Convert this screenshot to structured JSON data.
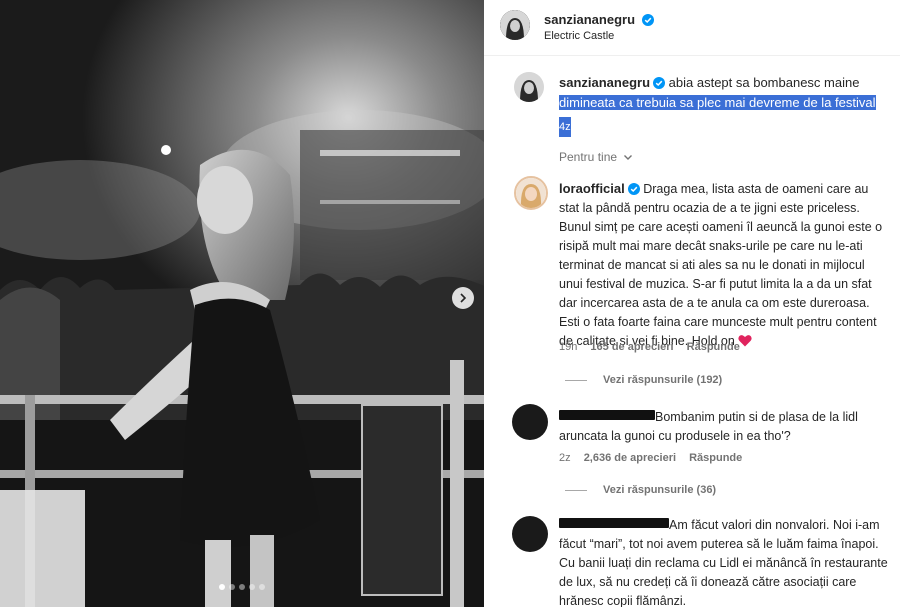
{
  "post": {
    "username": "sanziananegru",
    "location": "Electric Castle",
    "caption_part1": "abia astept sa bombanesc maine",
    "caption_part2": "dimineata ca trebuia sa plec mai devreme de la festival",
    "caption_time": "4z",
    "carousel": {
      "total": 5,
      "active": 0
    }
  },
  "filter": {
    "label": "Pentru tine"
  },
  "comments": [
    {
      "username": "loraofficial",
      "text": "Draga mea, lista asta de oameni care au stat la pândă pentru ocazia de a te jigni este priceless. Bunul simț pe care acești oameni îl aeuncă la gunoi este o risipă mult mai mare decât snaks-urile pe care nu le-ati terminat de mancat si ati ales sa nu le donati in mijlocul unui festival de muzica. S-ar fi putut limita la a da un sfat dar incercarea asta de a te anula ca om este dureroasa. Esti o fata foarte faina care munceste mult pentru content de calitate si vei fi bine. Hold on",
      "time": "19h",
      "likes": "165 de aprecieri",
      "reply": "Răspunde",
      "view_replies": "Vezi răspunsurile (192)",
      "heart_color": "#e0245e"
    },
    {
      "username": "",
      "text": "Bombanim putin si de plasa de la lidl aruncata la gunoi cu produsele in ea tho'?",
      "time": "2z",
      "likes": "2,636 de aprecieri",
      "reply": "Răspunde",
      "view_replies": "Vezi răspunsurile (36)"
    },
    {
      "username": "",
      "text": "Am făcut valori din nonvalori. Noi i-am făcut “mari”, tot noi avem puterea să le luăm faima înapoi. Cu banii luați din reclama cu Lidl ei mănâncă în restaurante de lux, să nu credeți că îi donează către asociații care hrănesc copii flămânzi."
    }
  ],
  "colors": {
    "verified": "#0095f6",
    "highlight": "#3b6fd6",
    "secondary_text": "#737373"
  }
}
